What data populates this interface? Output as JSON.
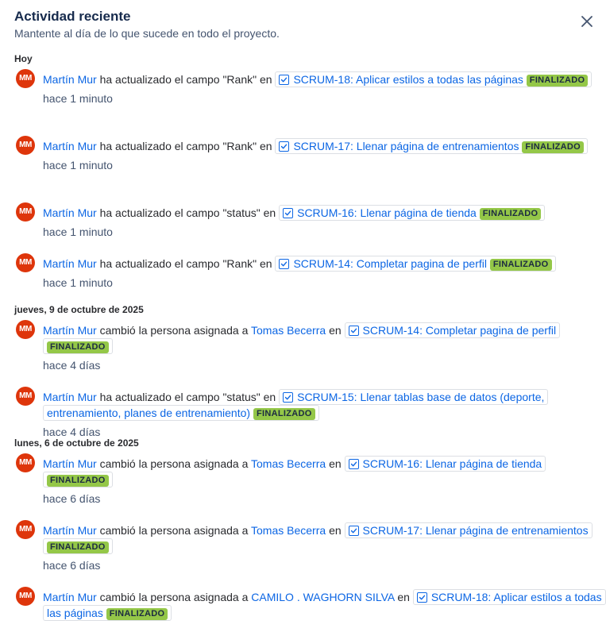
{
  "header": {
    "title": "Actividad reciente",
    "subtitle": "Mantente al día de lo que sucede en todo el proyecto."
  },
  "icons": {
    "close": "close-icon",
    "issue": "checkbox-icon"
  },
  "colors": {
    "avatar": "#de350b",
    "link": "#0c66e4",
    "badge": "#94c748"
  },
  "groups": [
    {
      "label": "Hoy",
      "items": [
        {
          "avatar": "MM",
          "user": "Martín Mur",
          "action": "ha actualizado el campo \"Rank\" en",
          "issue": "SCRUM-18: Aplicar estilos a todas las páginas",
          "status": "FINALIZADO",
          "time": "hace 1 minuto"
        },
        {
          "avatar": "MM",
          "user": "Martín Mur",
          "action": "ha actualizado el campo \"Rank\" en",
          "issue": "SCRUM-17: Llenar página de entrenamientos",
          "status": "FINALIZADO",
          "time": "hace 1 minuto"
        },
        {
          "avatar": "MM",
          "user": "Martín Mur",
          "action": "ha actualizado el campo \"status\" en",
          "issue": "SCRUM-16: Llenar página de tienda",
          "status": "FINALIZADO",
          "time": "hace 1 minuto"
        },
        {
          "avatar": "MM",
          "user": "Martín Mur",
          "action": "ha actualizado el campo \"Rank\" en",
          "issue": "SCRUM-14: Completar pagina de perfil",
          "status": "FINALIZADO",
          "time": "hace 1 minuto"
        }
      ]
    },
    {
      "label": "jueves, 9 de octubre de 2025",
      "items": [
        {
          "avatar": "MM",
          "user": "Martín Mur",
          "action": "cambió la persona asignada a",
          "assignee": "Tomas Becerra",
          "action2": "en",
          "issue": "SCRUM-14: Completar pagina de perfil",
          "status": "FINALIZADO",
          "time": "hace 4 días"
        },
        {
          "avatar": "MM",
          "user": "Martín Mur",
          "action": "ha actualizado el campo \"status\" en",
          "issue": "SCRUM-15: Llenar tablas base de datos (deporte, entrenamiento, planes de entrenamiento)",
          "status": "FINALIZADO",
          "time": "hace 4 días"
        }
      ]
    },
    {
      "label": "lunes, 6 de octubre de 2025",
      "items": [
        {
          "avatar": "MM",
          "user": "Martín Mur",
          "action": "cambió la persona asignada a",
          "assignee": "Tomas Becerra",
          "action2": "en",
          "issue": "SCRUM-16: Llenar página de tienda",
          "status": "FINALIZADO",
          "time": "hace 6 días"
        },
        {
          "avatar": "MM",
          "user": "Martín Mur",
          "action": "cambió la persona asignada a",
          "assignee": "Tomas Becerra",
          "action2": "en",
          "issue": "SCRUM-17: Llenar página de entrenamientos",
          "status": "FINALIZADO",
          "time": "hace 6 días"
        },
        {
          "avatar": "MM",
          "user": "Martín Mur",
          "action": "cambió la persona asignada a",
          "assignee": "CAMILO . WAGHORN SILVA",
          "action2": "en",
          "issue": "SCRUM-18: Aplicar estilos a todas las páginas",
          "status": "FINALIZADO",
          "time": ""
        }
      ]
    }
  ]
}
